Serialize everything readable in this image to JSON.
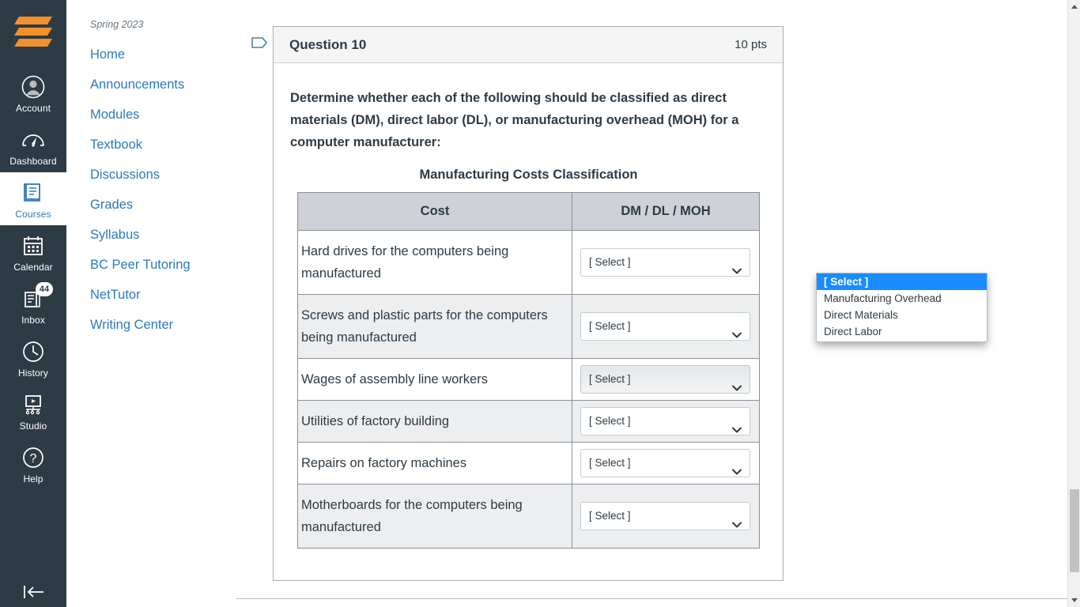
{
  "global_nav": {
    "logo_name": "canvas-logo",
    "items": [
      {
        "label": "Account",
        "icon": "account-icon",
        "active": false,
        "badge": null
      },
      {
        "label": "Dashboard",
        "icon": "dashboard-icon",
        "active": false,
        "badge": null
      },
      {
        "label": "Courses",
        "icon": "courses-icon",
        "active": true,
        "badge": null
      },
      {
        "label": "Calendar",
        "icon": "calendar-icon",
        "active": false,
        "badge": null
      },
      {
        "label": "Inbox",
        "icon": "inbox-icon",
        "active": false,
        "badge": "44"
      },
      {
        "label": "History",
        "icon": "history-icon",
        "active": false,
        "badge": null
      },
      {
        "label": "Studio",
        "icon": "studio-icon",
        "active": false,
        "badge": null
      },
      {
        "label": "Help",
        "icon": "help-icon",
        "active": false,
        "badge": null
      }
    ],
    "collapse_icon": "collapse-nav-icon"
  },
  "course_nav": {
    "term": "Spring 2023",
    "items": [
      {
        "label": "Home"
      },
      {
        "label": "Announcements"
      },
      {
        "label": "Modules"
      },
      {
        "label": "Textbook"
      },
      {
        "label": "Discussions"
      },
      {
        "label": "Grades"
      },
      {
        "label": "Syllabus"
      },
      {
        "label": "BC Peer Tutoring"
      },
      {
        "label": "NetTutor"
      },
      {
        "label": "Writing Center"
      }
    ]
  },
  "question": {
    "flag_icon": "flag-icon",
    "title": "Question 10",
    "points": "10 pts",
    "prompt": "Determine whether each of the following should be classified as direct materials (DM), direct labor (DL), or manufacturing overhead (MOH) for a computer manufacturer:",
    "table_caption": "Manufacturing Costs Classification",
    "columns": [
      "Cost",
      "DM / DL / MOH"
    ],
    "rows": [
      {
        "cost": "Hard drives for the computers being manufactured",
        "selected": "[ Select ]"
      },
      {
        "cost": "Screws and plastic parts for the computers being manufactured",
        "selected": "[ Select ]"
      },
      {
        "cost": "Wages of assembly line workers",
        "selected": "[ Select ]"
      },
      {
        "cost": "Utilities of factory building",
        "selected": "[ Select ]"
      },
      {
        "cost": "Repairs on factory machines",
        "selected": "[ Select ]"
      },
      {
        "cost": "Motherboards for the computers being manufactured",
        "selected": "[ Select ]"
      }
    ],
    "open_dropdown": {
      "row_index": 0,
      "options": [
        "[ Select ]",
        "Manufacturing Overhead",
        "Direct Materials",
        "Direct Labor"
      ],
      "highlighted": "[ Select ]"
    }
  },
  "scrollbar": {
    "up_icon": "scroll-up-arrow-icon",
    "down_icon": "scroll-down-arrow-icon",
    "thumb_name": "scroll-thumb"
  },
  "colors": {
    "nav_bg": "#2D3B45",
    "link_blue": "#2B7ABC",
    "logo_orange": "#F2912B",
    "table_header_bg": "#ced2d8",
    "row_alt_bg": "#eceef0",
    "dropdown_highlight": "#1a8cff"
  }
}
